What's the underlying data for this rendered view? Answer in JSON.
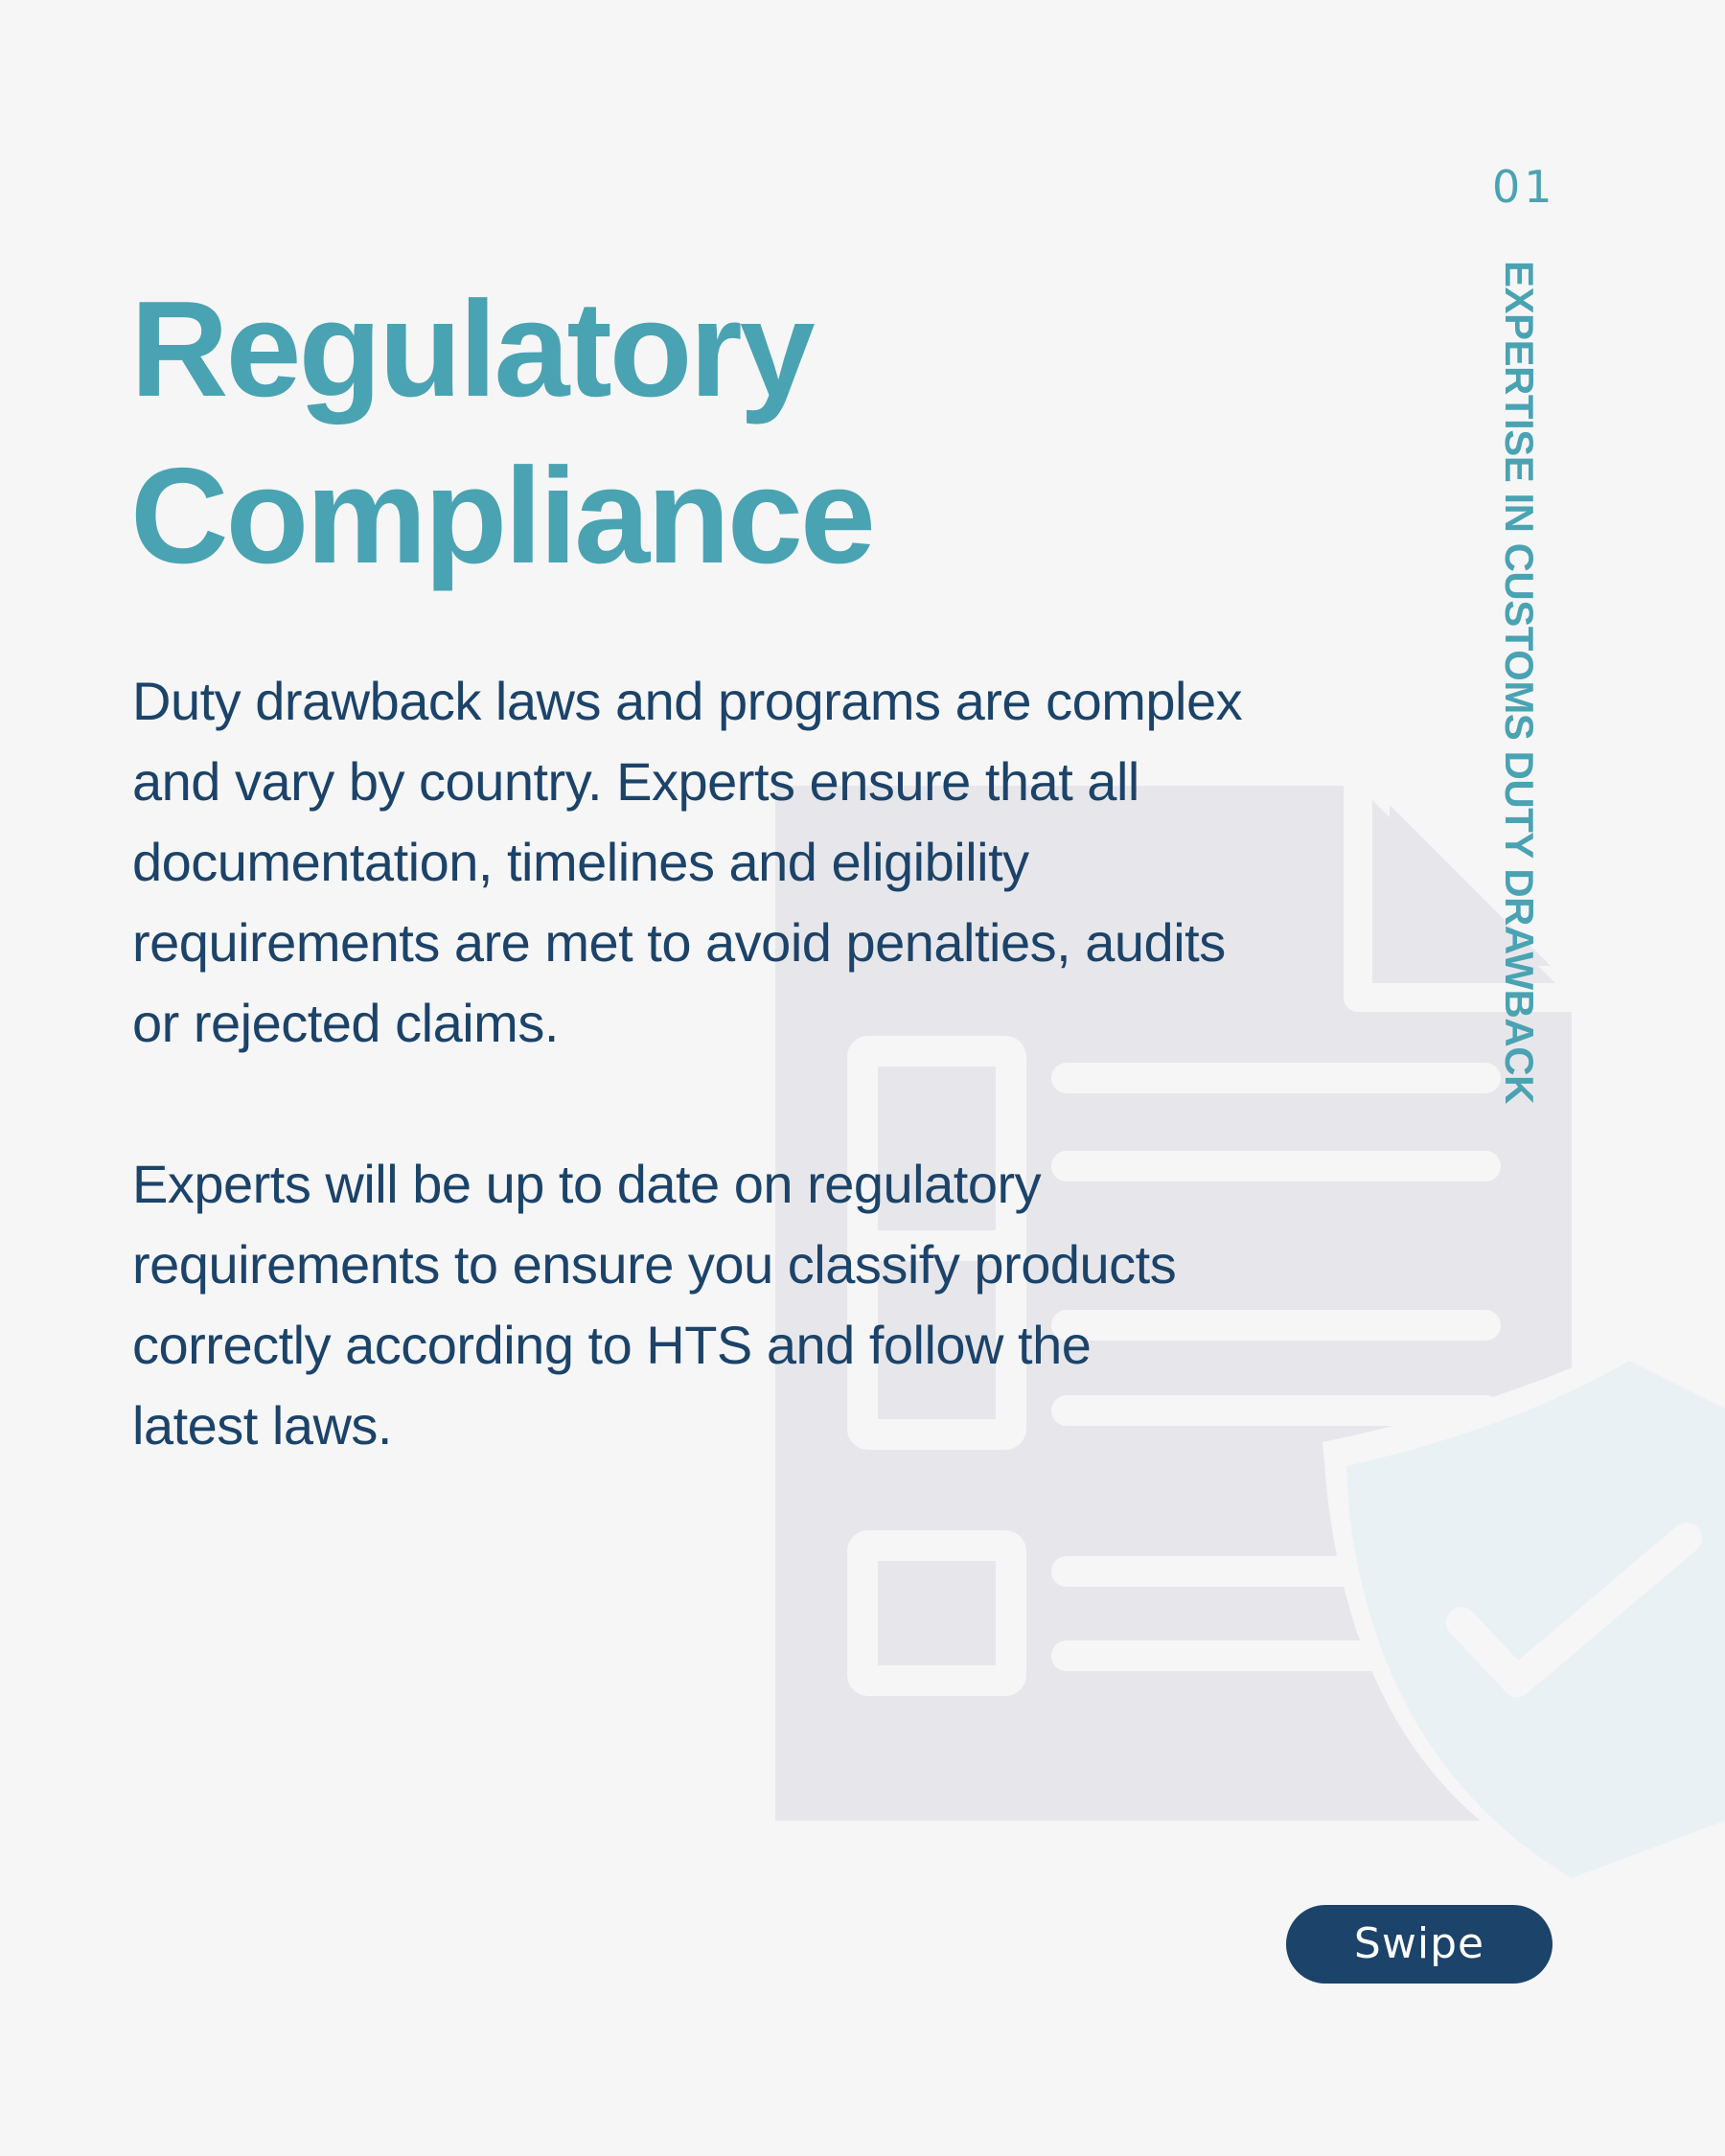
{
  "slide": {
    "page_number": "01",
    "side_label": "EXPERTISE IN CUSTOMS DUTY DRAWBACK",
    "title_lines": [
      "Regulatory",
      "Compliance"
    ],
    "paragraphs": [
      {
        "lines": [
          "Duty drawback laws and programs are complex",
          "and vary by country. Experts ensure that all",
          "documentation, timelines and eligibility",
          "requirements are met to avoid penalties, audits",
          "or rejected claims."
        ]
      },
      {
        "lines": [
          "Experts will be up to date on regulatory",
          "requirements to ensure you classify products",
          "correctly according to HTS and follow the",
          "latest laws."
        ]
      }
    ],
    "swipe_label": "Swipe"
  },
  "icons": {
    "background_document": "checklist-document-icon",
    "background_shield": "shield-check-icon"
  },
  "colors": {
    "background": "#f6f6f7",
    "accent_teal": "#4aa3b2",
    "navy": "#1c4369",
    "document_gray": "#e7e7eb",
    "shield_tint": "#e9f1f5"
  }
}
